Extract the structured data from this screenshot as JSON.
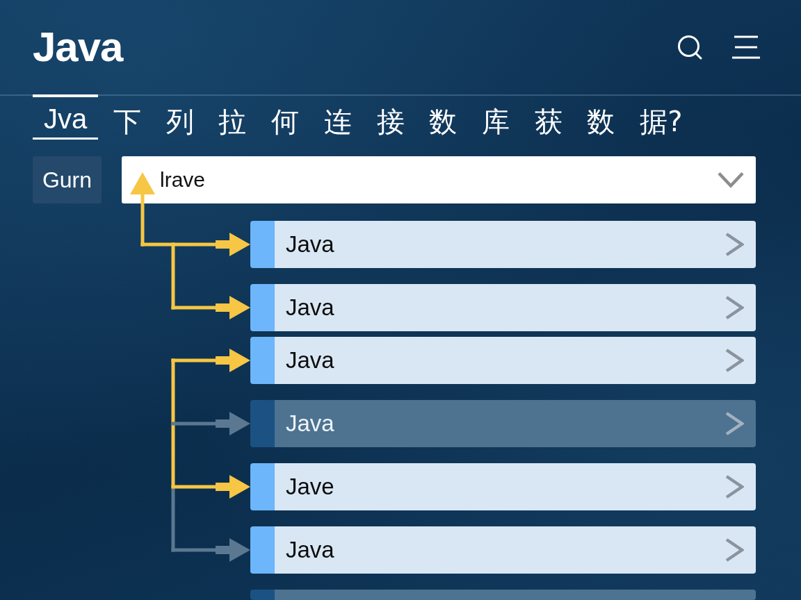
{
  "header": {
    "logo": "Java"
  },
  "tabs": [
    {
      "label": "Jva",
      "selected": true
    }
  ],
  "question": "下 列 拉 何 连 接 数 库 获 数 据?",
  "field_label": "Gurn",
  "dropdown": {
    "value": "lrave"
  },
  "option_groups": [
    {
      "linked_to_field": true,
      "options": [
        {
          "label": "Java",
          "dimmed": false,
          "connected": true
        },
        {
          "label": "Java",
          "dimmed": false,
          "connected": true
        }
      ]
    },
    {
      "linked_to_field": false,
      "options": [
        {
          "label": "Java",
          "dimmed": false,
          "connected": true
        },
        {
          "label": "Java",
          "dimmed": true,
          "connected": false
        },
        {
          "label": "Jave",
          "dimmed": false,
          "connected": true
        },
        {
          "label": "Java",
          "dimmed": false,
          "connected": false
        },
        {
          "dimmed": true
        }
      ]
    }
  ]
}
